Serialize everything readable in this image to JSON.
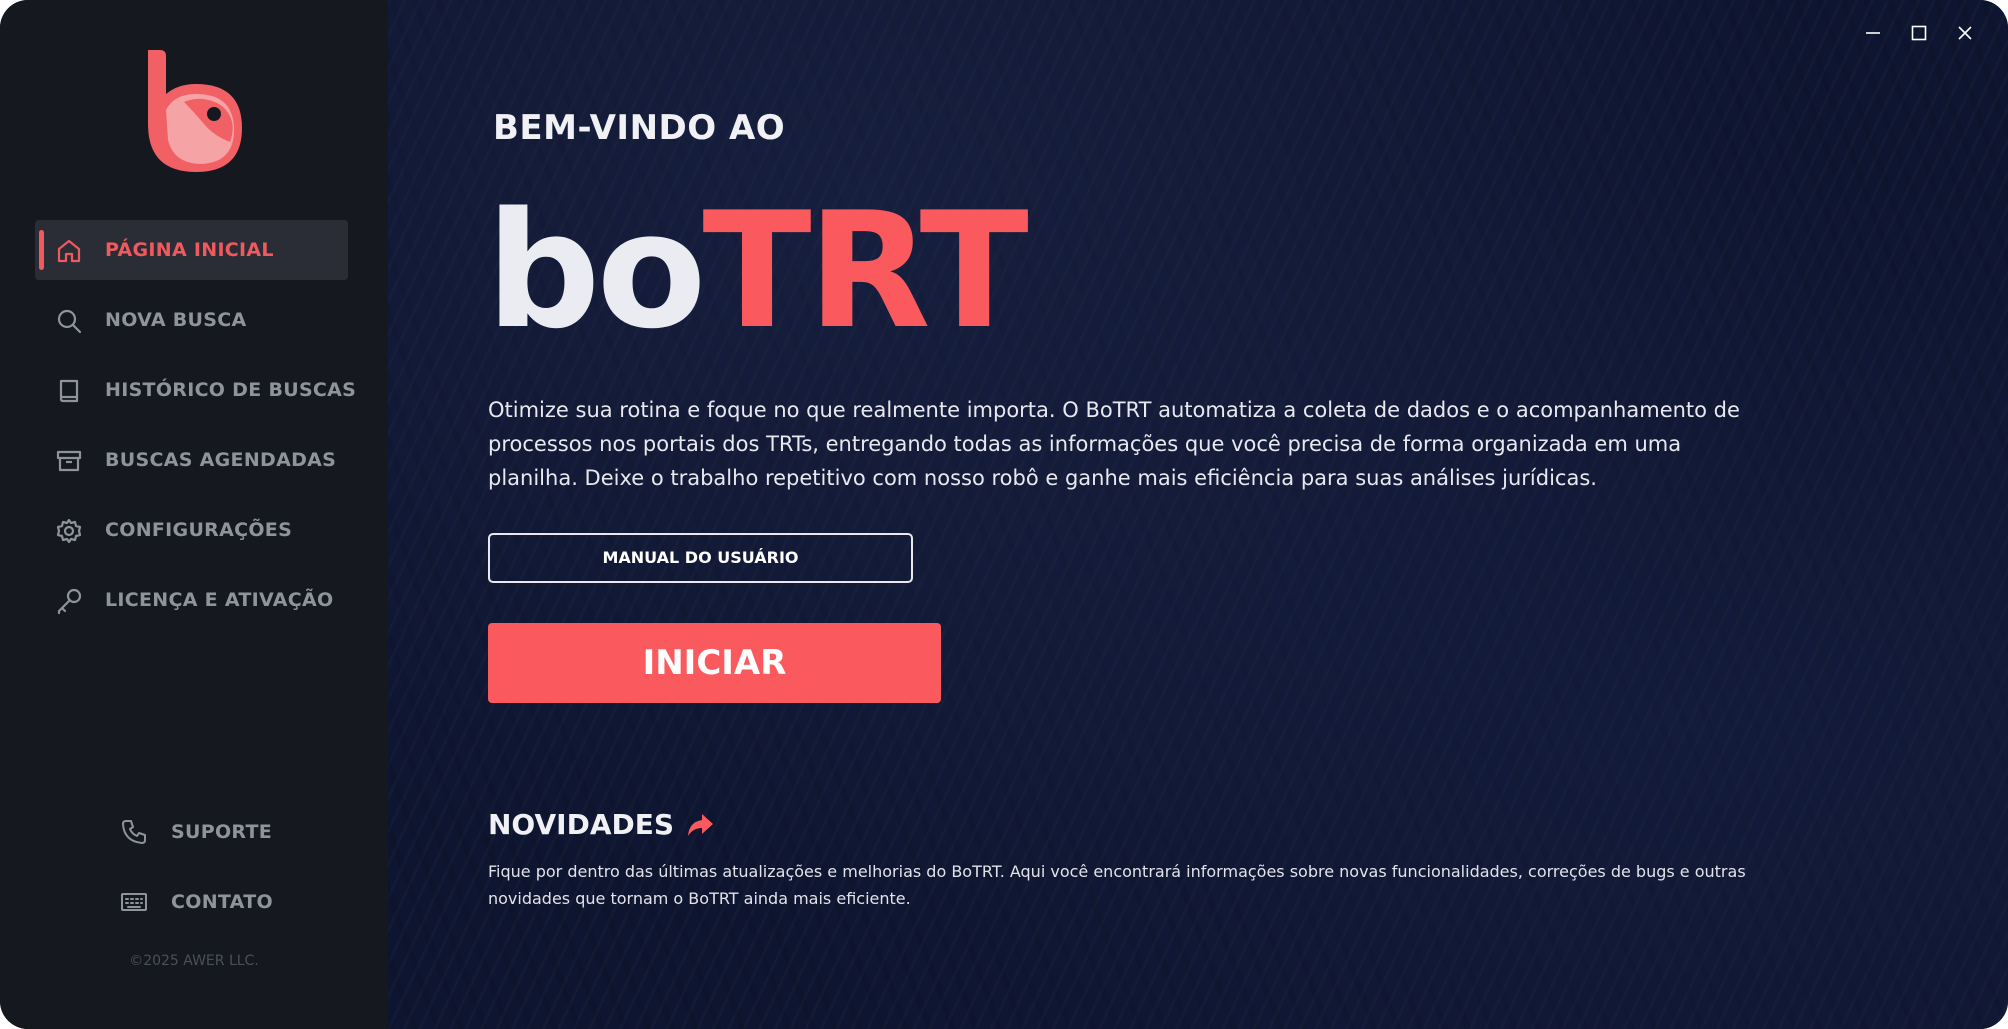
{
  "sidebar": {
    "nav": [
      {
        "label": "PÁGINA INICIAL",
        "icon": "home-icon",
        "active": true
      },
      {
        "label": "NOVA BUSCA",
        "icon": "search-icon",
        "active": false
      },
      {
        "label": "HISTÓRICO DE BUSCAS",
        "icon": "book-icon",
        "active": false
      },
      {
        "label": "BUSCAS AGENDADAS",
        "icon": "archive-icon",
        "active": false
      },
      {
        "label": "CONFIGURAÇÕES",
        "icon": "gear-icon",
        "active": false
      },
      {
        "label": "LICENÇA E ATIVAÇÃO",
        "icon": "key-icon",
        "active": false
      }
    ],
    "footer": [
      {
        "label": "SUPORTE",
        "icon": "phone-icon"
      },
      {
        "label": "CONTATO",
        "icon": "keyboard-icon"
      }
    ],
    "copyright": "©2025 AWER LLC."
  },
  "main": {
    "welcome": "BEM-VINDO AO",
    "brand_bo": "bo",
    "brand_trt": "TRT",
    "description": "Otimize sua rotina e foque no que realmente importa. O BoTRT automatiza a coleta de dados e o acompanhamento de processos nos portais dos TRTs, entregando todas as informações que você precisa de forma organizada em uma planilha. Deixe o trabalho repetitivo com nosso robô e ganhe mais eficiência para suas análises jurídicas.",
    "manual_button": "MANUAL DO USUÁRIO",
    "start_button": "INICIAR",
    "news_title": "NOVIDADES",
    "news_description": "Fique por dentro das últimas atualizações e melhorias do BoTRT. Aqui você encontrará informações sobre novas funcionalidades, correções de bugs e outras novidades que tornam o BoTRT ainda mais eficiente."
  },
  "colors": {
    "accent": "#fa5a5e",
    "sidebar_bg": "#15181f",
    "main_bg": "#0e1530",
    "nav_text": "#8f939c"
  }
}
